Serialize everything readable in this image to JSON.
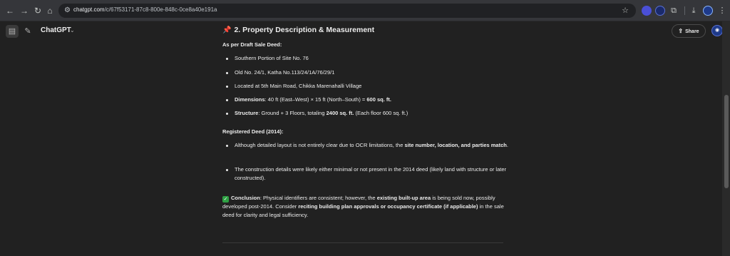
{
  "browser": {
    "url_host": "chatgpt.com",
    "url_path": "/c/67f53171-87c8-800e-848c-0ce8a40e191a",
    "back_icon": "arrow-left-icon",
    "forward_icon": "arrow-right-icon",
    "reload_icon": "reload-icon",
    "home_icon": "home-icon"
  },
  "header": {
    "model_name": "ChatGPT",
    "share_label": "Share"
  },
  "message": {
    "heading": "2. Property Description & Measurement",
    "draft_title": "As per Draft Sale Deed:",
    "draft_items": [
      {
        "text": "Southern Portion of Site No. 76"
      },
      {
        "text": "Old No. 24/1, Katha No.113/24/1A/76/29/1"
      },
      {
        "text": "Located at 5th Main Road, Chikka Marenahalli Village"
      },
      {
        "label": "Dimensions",
        "text_a": ": 40 ft (East–West) × 15 ft (North–South) = ",
        "bold": "600 sq. ft."
      },
      {
        "label": "Structure",
        "text_a": ": Ground + 3 Floors, totaling ",
        "bold": "2400 sq. ft.",
        "text_b": " (Each floor 600 sq. ft.)"
      }
    ],
    "registered_title": "Registered Deed (2014):",
    "registered_items": [
      {
        "text_a": "Although detailed layout is not entirely clear due to OCR limitations, the ",
        "bold": "site number, location, and parties match",
        "text_b": "."
      },
      {
        "text_a": "The construction details were likely either minimal or not present in the 2014 deed (likely land with structure or later constructed)."
      }
    ],
    "conclusion": {
      "label": "Conclusion",
      "t1": ": Physical identifiers are consistent; however, the ",
      "b1": "existing built-up area",
      "t2": " is being sold now, possibly developed post-2014. Consider ",
      "b2": "reciting building plan approvals or occupancy certificate (if applicable)",
      "t3": " in the sale deed for clarity and legal sufficiency."
    }
  },
  "colors": {
    "background": "#212121",
    "chrome": "#35363a",
    "text": "#ececec",
    "check": "#2ea043",
    "pin": "#e74c3c"
  }
}
